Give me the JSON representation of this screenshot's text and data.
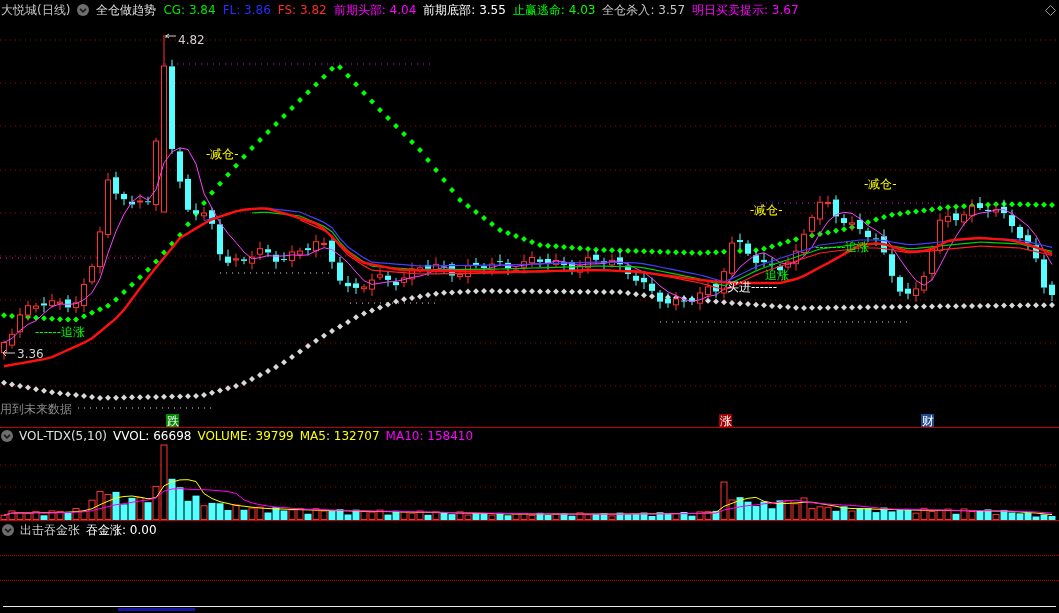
{
  "header": {
    "title": "大悦城(日线)",
    "indicator": "全仓做趋势",
    "values": [
      {
        "text": "CG: 3.84",
        "color": "#00e600"
      },
      {
        "text": "FL: 3.86",
        "color": "#2b2bff"
      },
      {
        "text": "FS: 3.82",
        "color": "#ff2b2b"
      },
      {
        "text": "前期头部: 4.04",
        "color": "#ff00ff"
      },
      {
        "text": "前期底部: 3.55",
        "color": "#ffffff"
      },
      {
        "text": "止赢逃命: 4.03",
        "color": "#00ff00"
      },
      {
        "text": "全仓杀入: 3.57",
        "color": "#c8c8c8"
      },
      {
        "text": "明日买卖提示: 3.67",
        "color": "#ff00ff"
      }
    ]
  },
  "price_chart": {
    "annotations": [
      {
        "kind": "price",
        "text": "4.82"
      },
      {
        "kind": "price",
        "text": "3.36"
      },
      {
        "kind": "reduce",
        "text": "-减仓-"
      },
      {
        "kind": "reduce",
        "text": "-减仓-"
      },
      {
        "kind": "reduce",
        "text": "-减仓-"
      },
      {
        "kind": "chase",
        "text": "------追涨"
      },
      {
        "kind": "chase",
        "text": "追涨"
      },
      {
        "kind": "chase",
        "text": "-------追涨"
      },
      {
        "kind": "buy",
        "text": "买进------"
      },
      {
        "kind": "note",
        "text": "用到未来数据"
      }
    ],
    "markers": [
      {
        "text": "跌",
        "color": "#008a00"
      },
      {
        "text": "涨",
        "color": "#a00000"
      },
      {
        "text": "财",
        "color": "#1e4b8c"
      }
    ]
  },
  "volume_panel": {
    "indicator": "VOL-TDX(5,10)",
    "values": [
      {
        "text": "VVOL: 66698",
        "color": "#ffffff"
      },
      {
        "text": "VOLUME: 39799",
        "color": "#ffff00"
      },
      {
        "text": "MA5: 132707",
        "color": "#ffff00"
      },
      {
        "text": "MA10: 158410",
        "color": "#ff00ff"
      }
    ]
  },
  "bottom_panel": {
    "indicator": "出击吞金张",
    "values": [
      {
        "text": "吞金涨: 0.00",
        "color": "#ffffff"
      }
    ]
  }
}
